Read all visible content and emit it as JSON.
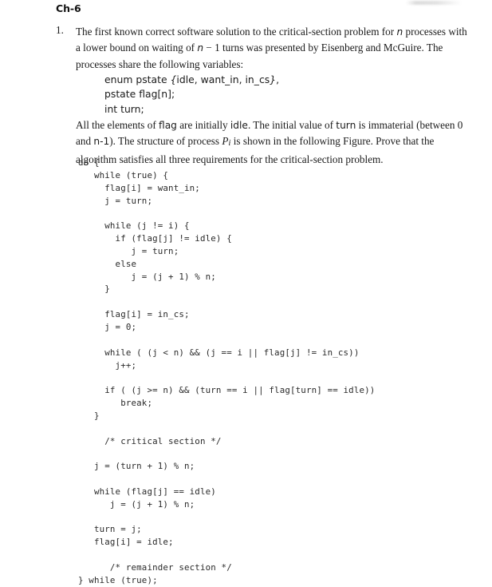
{
  "heading": "Ch-6",
  "problem": {
    "number": "1.",
    "para1_a": "The first known correct software solution to the critical-section problem for ",
    "para1_n1": "n",
    "para1_b": " processes with a lower bound on waiting of ",
    "para1_n2": "n",
    "para1_c": " − 1 turns was presented by Eisenberg and McGuire. The processes share the following variables:",
    "variables": [
      "enum pstate  idle, want_in, in_cs ;",
      "pstate flag[n];",
      "int turn;"
    ],
    "var_enum_prefix": "enum pstate ",
    "var_enum_open": "{",
    "var_enum_items": "idle, want_in, in_cs",
    "var_enum_close": "}",
    "var_enum_semi": ",",
    "var_flag": "pstate flag[n];",
    "var_turn": "int turn;",
    "para2_a": "All the elements of ",
    "para2_flag": "flag",
    "para2_b": " are initially ",
    "para2_idle": "idle",
    "para2_c": ". The initial value of ",
    "para2_turn": "turn",
    "para2_d": " is immaterial (between 0 and ",
    "para2_n1": "n-1",
    "para2_e": "). The structure of process ",
    "para2_P": "P",
    "para2_Psub": "i",
    "para2_f": " is shown in the following Figure. Prove that the algorithm satisfies all three requirements for the critical-section problem."
  },
  "code": {
    "lines": [
      "do {",
      "   while (true) {",
      "     flag[i] = want_in;",
      "     j = turn;",
      "",
      "     while (j != i) {",
      "       if (flag[j] != idle) {",
      "          j = turn;",
      "       else",
      "          j = (j + 1) % n;",
      "     }",
      "",
      "     flag[i] = in_cs;",
      "     j = 0;",
      "",
      "     while ( (j < n) && (j == i || flag[j] != in_cs))",
      "       j++;",
      "",
      "     if ( (j >= n) && (turn == i || flag[turn] == idle))",
      "        break;",
      "   }",
      "",
      "     /* critical section */",
      "",
      "   j = (turn + 1) % n;",
      "",
      "   while (flag[j] == idle)",
      "      j = (j + 1) % n;",
      "",
      "   turn = j;",
      "   flag[i] = idle;",
      "",
      "      /* remainder section */",
      "} while (true);"
    ]
  }
}
